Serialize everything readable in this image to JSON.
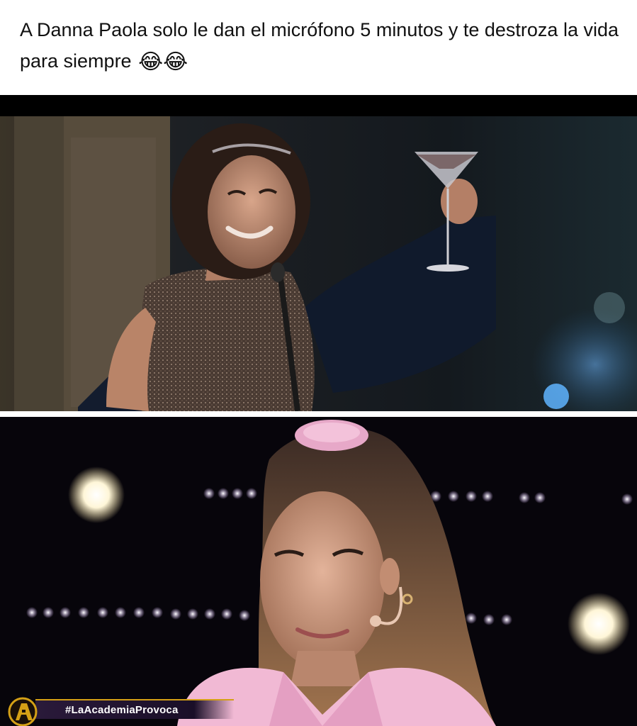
{
  "post": {
    "caption_text": "A Danna Paola solo le dan el micrófono 5 minutos y te destroza la vida para siempre",
    "caption_emojis": "😂😂"
  },
  "bottom_panel": {
    "hashtag": "#LaAcademiaProvoca",
    "logo_icon": "la-academia-logo-icon"
  },
  "colors": {
    "caption_text": "#111111",
    "ticker_accent": "#d4a016",
    "ticker_bg": "#1a0f28"
  }
}
